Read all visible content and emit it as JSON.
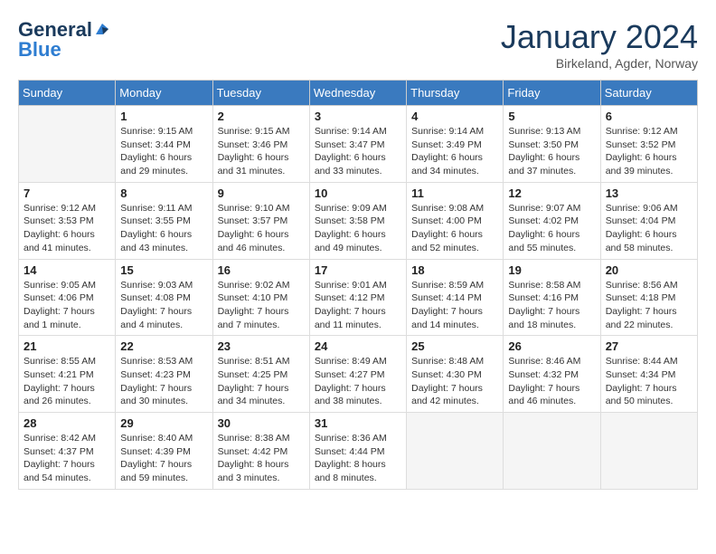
{
  "logo": {
    "line1": "General",
    "line2": "Blue"
  },
  "title": "January 2024",
  "subtitle": "Birkeland, Agder, Norway",
  "days_of_week": [
    "Sunday",
    "Monday",
    "Tuesday",
    "Wednesday",
    "Thursday",
    "Friday",
    "Saturday"
  ],
  "weeks": [
    [
      {
        "day": "",
        "info": ""
      },
      {
        "day": "1",
        "info": "Sunrise: 9:15 AM\nSunset: 3:44 PM\nDaylight: 6 hours\nand 29 minutes."
      },
      {
        "day": "2",
        "info": "Sunrise: 9:15 AM\nSunset: 3:46 PM\nDaylight: 6 hours\nand 31 minutes."
      },
      {
        "day": "3",
        "info": "Sunrise: 9:14 AM\nSunset: 3:47 PM\nDaylight: 6 hours\nand 33 minutes."
      },
      {
        "day": "4",
        "info": "Sunrise: 9:14 AM\nSunset: 3:49 PM\nDaylight: 6 hours\nand 34 minutes."
      },
      {
        "day": "5",
        "info": "Sunrise: 9:13 AM\nSunset: 3:50 PM\nDaylight: 6 hours\nand 37 minutes."
      },
      {
        "day": "6",
        "info": "Sunrise: 9:12 AM\nSunset: 3:52 PM\nDaylight: 6 hours\nand 39 minutes."
      }
    ],
    [
      {
        "day": "7",
        "info": "Sunrise: 9:12 AM\nSunset: 3:53 PM\nDaylight: 6 hours\nand 41 minutes."
      },
      {
        "day": "8",
        "info": "Sunrise: 9:11 AM\nSunset: 3:55 PM\nDaylight: 6 hours\nand 43 minutes."
      },
      {
        "day": "9",
        "info": "Sunrise: 9:10 AM\nSunset: 3:57 PM\nDaylight: 6 hours\nand 46 minutes."
      },
      {
        "day": "10",
        "info": "Sunrise: 9:09 AM\nSunset: 3:58 PM\nDaylight: 6 hours\nand 49 minutes."
      },
      {
        "day": "11",
        "info": "Sunrise: 9:08 AM\nSunset: 4:00 PM\nDaylight: 6 hours\nand 52 minutes."
      },
      {
        "day": "12",
        "info": "Sunrise: 9:07 AM\nSunset: 4:02 PM\nDaylight: 6 hours\nand 55 minutes."
      },
      {
        "day": "13",
        "info": "Sunrise: 9:06 AM\nSunset: 4:04 PM\nDaylight: 6 hours\nand 58 minutes."
      }
    ],
    [
      {
        "day": "14",
        "info": "Sunrise: 9:05 AM\nSunset: 4:06 PM\nDaylight: 7 hours\nand 1 minute."
      },
      {
        "day": "15",
        "info": "Sunrise: 9:03 AM\nSunset: 4:08 PM\nDaylight: 7 hours\nand 4 minutes."
      },
      {
        "day": "16",
        "info": "Sunrise: 9:02 AM\nSunset: 4:10 PM\nDaylight: 7 hours\nand 7 minutes."
      },
      {
        "day": "17",
        "info": "Sunrise: 9:01 AM\nSunset: 4:12 PM\nDaylight: 7 hours\nand 11 minutes."
      },
      {
        "day": "18",
        "info": "Sunrise: 8:59 AM\nSunset: 4:14 PM\nDaylight: 7 hours\nand 14 minutes."
      },
      {
        "day": "19",
        "info": "Sunrise: 8:58 AM\nSunset: 4:16 PM\nDaylight: 7 hours\nand 18 minutes."
      },
      {
        "day": "20",
        "info": "Sunrise: 8:56 AM\nSunset: 4:18 PM\nDaylight: 7 hours\nand 22 minutes."
      }
    ],
    [
      {
        "day": "21",
        "info": "Sunrise: 8:55 AM\nSunset: 4:21 PM\nDaylight: 7 hours\nand 26 minutes."
      },
      {
        "day": "22",
        "info": "Sunrise: 8:53 AM\nSunset: 4:23 PM\nDaylight: 7 hours\nand 30 minutes."
      },
      {
        "day": "23",
        "info": "Sunrise: 8:51 AM\nSunset: 4:25 PM\nDaylight: 7 hours\nand 34 minutes."
      },
      {
        "day": "24",
        "info": "Sunrise: 8:49 AM\nSunset: 4:27 PM\nDaylight: 7 hours\nand 38 minutes."
      },
      {
        "day": "25",
        "info": "Sunrise: 8:48 AM\nSunset: 4:30 PM\nDaylight: 7 hours\nand 42 minutes."
      },
      {
        "day": "26",
        "info": "Sunrise: 8:46 AM\nSunset: 4:32 PM\nDaylight: 7 hours\nand 46 minutes."
      },
      {
        "day": "27",
        "info": "Sunrise: 8:44 AM\nSunset: 4:34 PM\nDaylight: 7 hours\nand 50 minutes."
      }
    ],
    [
      {
        "day": "28",
        "info": "Sunrise: 8:42 AM\nSunset: 4:37 PM\nDaylight: 7 hours\nand 54 minutes."
      },
      {
        "day": "29",
        "info": "Sunrise: 8:40 AM\nSunset: 4:39 PM\nDaylight: 7 hours\nand 59 minutes."
      },
      {
        "day": "30",
        "info": "Sunrise: 8:38 AM\nSunset: 4:42 PM\nDaylight: 8 hours\nand 3 minutes."
      },
      {
        "day": "31",
        "info": "Sunrise: 8:36 AM\nSunset: 4:44 PM\nDaylight: 8 hours\nand 8 minutes."
      },
      {
        "day": "",
        "info": ""
      },
      {
        "day": "",
        "info": ""
      },
      {
        "day": "",
        "info": ""
      }
    ]
  ]
}
